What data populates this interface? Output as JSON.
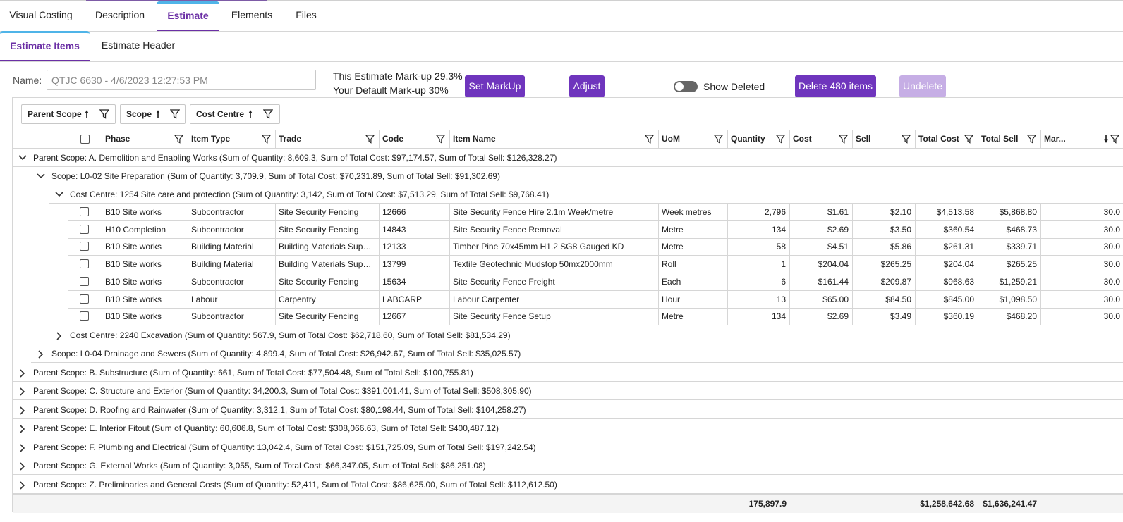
{
  "tabs": [
    "Visual Costing",
    "Description",
    "Estimate",
    "Elements",
    "Files"
  ],
  "subtabs": [
    "Estimate Items",
    "Estimate Header"
  ],
  "toolbar": {
    "name_label": "Name:",
    "name_value": "QTJC 6630 - 4/6/2023 12:27:53 PM",
    "markup_line1": "This Estimate Mark-up 29.3%",
    "markup_line2": "Your Default Mark-up 30%",
    "set_markup": "Set MarkUp",
    "adjust": "Adjust",
    "show_deleted": "Show Deleted",
    "delete_items": "Delete 480 items",
    "undelete": "Undelete"
  },
  "grouping": [
    "Parent Scope",
    "Scope",
    "Cost Centre"
  ],
  "columns": [
    "Phase",
    "Item Type",
    "Trade",
    "Code",
    "Item Name",
    "UoM",
    "Quantity",
    "Cost",
    "Sell",
    "Total Cost",
    "Total Sell",
    "Mar..."
  ],
  "groups": {
    "ps_a": "Parent Scope: A. Demolition and Enabling Works (Sum of Quantity: 8,609.3, Sum of Total Cost: $97,174.57, Sum of Total Sell: $126,328.27)",
    "scope_l002": "Scope: L0-02 Site Preparation (Sum of Quantity: 3,709.9, Sum of Total Cost: $70,231.89, Sum of Total Sell: $91,302.69)",
    "cc_1254": "Cost Centre: 1254 Site care and protection (Sum of Quantity: 3,142, Sum of Total Cost: $7,513.29, Sum of Total Sell: $9,768.41)",
    "cc_2240": "Cost Centre: 2240 Excavation (Sum of Quantity: 567.9, Sum of Total Cost: $62,718.60, Sum of Total Sell: $81,534.29)",
    "scope_l004": "Scope: L0-04 Drainage and Sewers (Sum of Quantity: 4,899.4, Sum of Total Cost: $26,942.67, Sum of Total Sell: $35,025.57)",
    "parent_scopes": [
      "Parent Scope: B. Substructure (Sum of Quantity: 661, Sum of Total Cost: $77,504.48, Sum of Total Sell: $100,755.81)",
      "Parent Scope: C. Structure and Exterior (Sum of Quantity: 34,200.3, Sum of Total Cost: $391,001.41, Sum of Total Sell: $508,305.90)",
      "Parent Scope: D. Roofing and Rainwater (Sum of Quantity: 3,312.1, Sum of Total Cost: $80,198.44, Sum of Total Sell: $104,258.27)",
      "Parent Scope: E. Interior Fitout (Sum of Quantity: 60,606.8, Sum of Total Cost: $308,066.63, Sum of Total Sell: $400,487.12)",
      "Parent Scope: F. Plumbing and Electrical (Sum of Quantity: 13,042.4, Sum of Total Cost: $151,725.09, Sum of Total Sell: $197,242.54)",
      "Parent Scope: G. External Works (Sum of Quantity: 3,055, Sum of Total Cost: $66,347.05, Sum of Total Sell: $86,251.08)",
      "Parent Scope: Z. Preliminaries and General Costs (Sum of Quantity: 52,411, Sum of Total Cost: $86,625.00, Sum of Total Sell: $112,612.50)"
    ]
  },
  "rows": [
    [
      "B10 Site works",
      "Subcontractor",
      "Site Security Fencing",
      "12666",
      "Site Security Fence Hire 2.1m Week/metre",
      "Week metres",
      "2,796",
      "$1.61",
      "$2.10",
      "$4,513.58",
      "$5,868.80",
      "30.0"
    ],
    [
      "H10 Completion",
      "Subcontractor",
      "Site Security Fencing",
      "14843",
      "Site Security Fence Removal",
      "Metre",
      "134",
      "$2.69",
      "$3.50",
      "$360.54",
      "$468.73",
      "30.0"
    ],
    [
      "B10 Site works",
      "Building Material",
      "Building Materials Suppl...",
      "12133",
      "Timber Pine 70x45mm H1.2 SG8 Gauged KD",
      "Metre",
      "58",
      "$4.51",
      "$5.86",
      "$261.31",
      "$339.71",
      "30.0"
    ],
    [
      "B10 Site works",
      "Building Material",
      "Building Materials Suppl...",
      "13799",
      "Textile Geotechnic Mudstop 50mx2000mm",
      "Roll",
      "1",
      "$204.04",
      "$265.25",
      "$204.04",
      "$265.25",
      "30.0"
    ],
    [
      "B10 Site works",
      "Subcontractor",
      "Site Security Fencing",
      "15634",
      "Site Security Fence Freight",
      "Each",
      "6",
      "$161.44",
      "$209.87",
      "$968.63",
      "$1,259.21",
      "30.0"
    ],
    [
      "B10 Site works",
      "Labour",
      "Carpentry",
      "LABCARP",
      "Labour Carpenter",
      "Hour",
      "13",
      "$65.00",
      "$84.50",
      "$845.00",
      "$1,098.50",
      "30.0"
    ],
    [
      "B10 Site works",
      "Subcontractor",
      "Site Security Fencing",
      "12667",
      "Site Security Fence Setup",
      "Metre",
      "134",
      "$2.69",
      "$3.49",
      "$360.19",
      "$468.20",
      "30.0"
    ]
  ],
  "totals": {
    "quantity": "175,897.9",
    "total_cost": "$1,258,642.68",
    "total_sell": "$1,636,241.47"
  }
}
